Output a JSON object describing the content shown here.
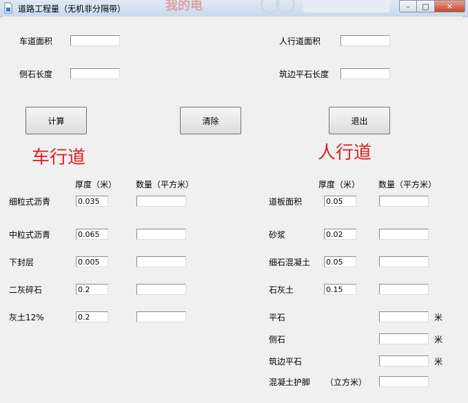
{
  "window": {
    "title": "道路工程量（无机非分隔带）",
    "background_watermark": "我的电",
    "controls": {
      "minimize": "–",
      "maximize": "□",
      "close": "✕"
    }
  },
  "top_fields": {
    "road_area": {
      "label": "车道面积",
      "value": ""
    },
    "curb_length": {
      "label": "侧石长度",
      "value": ""
    },
    "sidewalk_area": {
      "label": "人行道面积",
      "value": ""
    },
    "edge_flat_length": {
      "label": "筑边平石长度",
      "value": ""
    }
  },
  "buttons": {
    "calculate": "计算",
    "clear": "清除",
    "exit": "退出"
  },
  "roadway": {
    "heading": "车行道",
    "col_thickness": "厚度（米）",
    "col_quantity": "数量（平方米）",
    "rows": [
      {
        "label": "细粒式沥青",
        "thickness": "0.035",
        "quantity": ""
      },
      {
        "label": "中粒式沥青",
        "thickness": "0.065",
        "quantity": ""
      },
      {
        "label": "下封层",
        "thickness": "0.005",
        "quantity": ""
      },
      {
        "label": "二灰碎石",
        "thickness": "0.2",
        "quantity": ""
      },
      {
        "label": "灰土12%",
        "thickness": "0.2",
        "quantity": ""
      }
    ]
  },
  "sidewalk": {
    "heading": "人行道",
    "col_thickness": "厚度（米）",
    "col_quantity": "数量（平方米）",
    "rows": [
      {
        "label": "道板面积",
        "thickness": "0.05",
        "quantity": ""
      },
      {
        "label": "砂浆",
        "thickness": "0.02",
        "quantity": ""
      },
      {
        "label": "细石混凝土",
        "thickness": "0.05",
        "quantity": ""
      },
      {
        "label": "石灰土",
        "thickness": "0.15",
        "quantity": ""
      }
    ],
    "extra_rows": [
      {
        "label": "平石",
        "unit": "米",
        "quantity": ""
      },
      {
        "label": "侧石",
        "unit": "米",
        "quantity": ""
      },
      {
        "label": "筑边平石",
        "unit": "米",
        "quantity": ""
      },
      {
        "label": "混凝土护脚",
        "unit_label": "（立方米）",
        "quantity": ""
      }
    ]
  },
  "colors": {
    "heading_red": "#e02020",
    "window_bg": "#f0f0f0",
    "close_red": "#c8452f"
  }
}
